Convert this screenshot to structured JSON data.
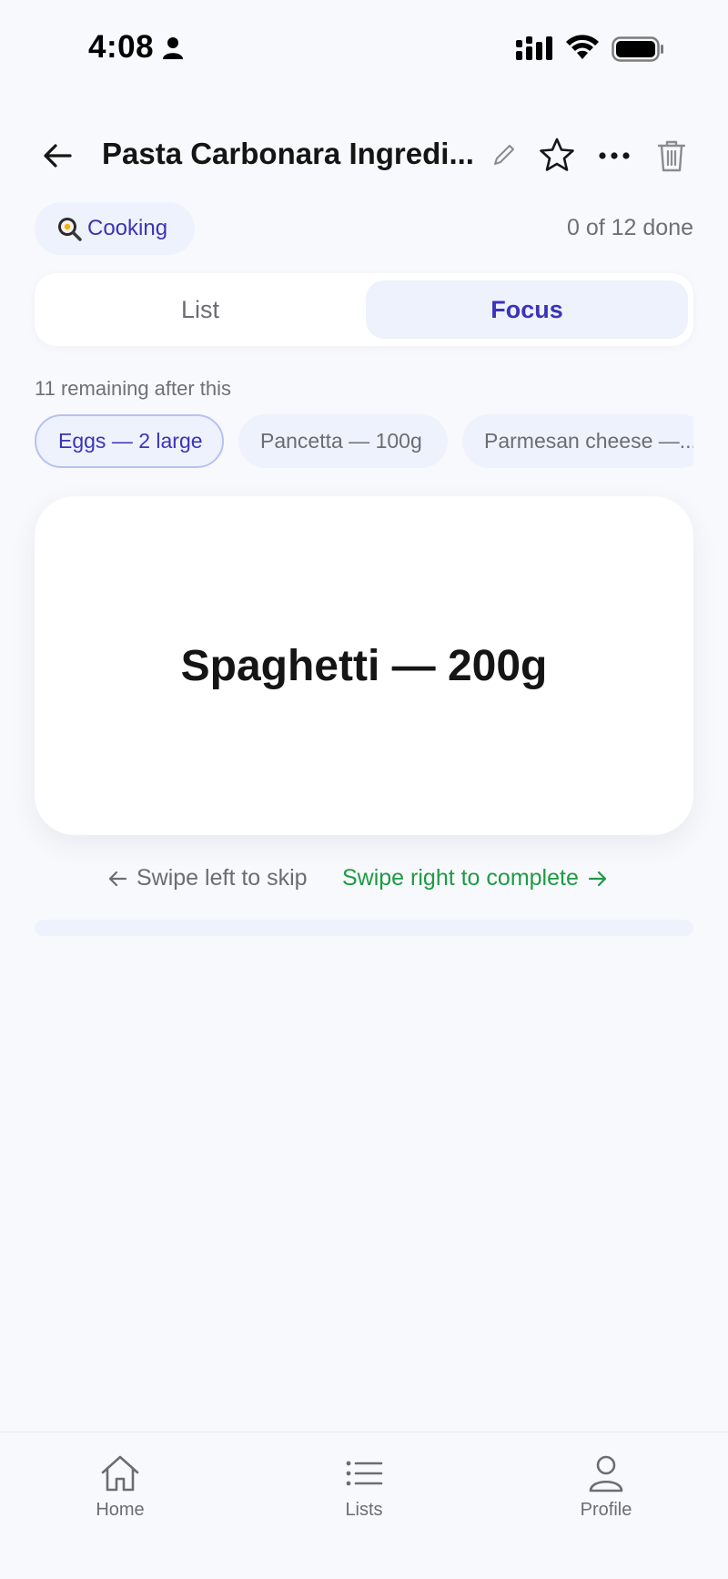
{
  "status_bar": {
    "time": "4:08"
  },
  "header": {
    "title": "Pasta Carbonara Ingredi..."
  },
  "category": {
    "label": "Cooking",
    "icon": "frying-pan-egg-icon"
  },
  "progress": {
    "text": "0 of 12 done",
    "done": 0,
    "total": 12
  },
  "view_toggle": {
    "list_label": "List",
    "focus_label": "Focus",
    "selected": "Focus"
  },
  "remaining_text": "11 remaining after this",
  "upcoming_items": [
    {
      "label": "Eggs — 2 large"
    },
    {
      "label": "Pancetta — 100g"
    },
    {
      "label": "Parmesan cheese —..."
    }
  ],
  "focus_item": {
    "label": "Spaghetti — 200g"
  },
  "swipe_hints": {
    "skip": "Swipe left to skip",
    "complete": "Swipe right to complete"
  },
  "bottom_nav": {
    "items": [
      {
        "label": "Home",
        "icon": "home-icon"
      },
      {
        "label": "Lists",
        "icon": "list-icon"
      },
      {
        "label": "Profile",
        "icon": "person-icon"
      }
    ]
  },
  "colors": {
    "accent": "#3b33b8",
    "accent_bg": "#eef2fd",
    "success": "#1e9a45",
    "background": "#f8f9fc"
  }
}
